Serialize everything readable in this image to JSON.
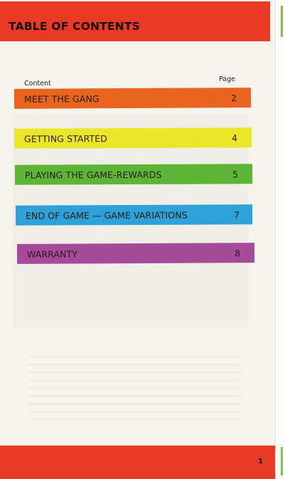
{
  "header": {
    "title": "TABLE OF CONTENTS"
  },
  "columns": {
    "content": "Content",
    "page": "Page"
  },
  "toc": [
    {
      "label": "MEET THE GANG",
      "page": "2",
      "color": "#e8641f"
    },
    {
      "label": "GETTING STARTED",
      "page": "4",
      "color": "#ece62a"
    },
    {
      "label": "PLAYING THE GAME-REWARDS",
      "page": "5",
      "color": "#5cb535"
    },
    {
      "label": "END OF GAME — GAME VARIATIONS",
      "page": "7",
      "color": "#2ea1d8"
    },
    {
      "label": "WARRANTY",
      "page": "8",
      "color": "#a64a9a"
    }
  ],
  "footer": {
    "page_number": "1"
  },
  "colors": {
    "header": "#e93a25",
    "footer": "#e93a25",
    "page": "#f7f4ee"
  }
}
